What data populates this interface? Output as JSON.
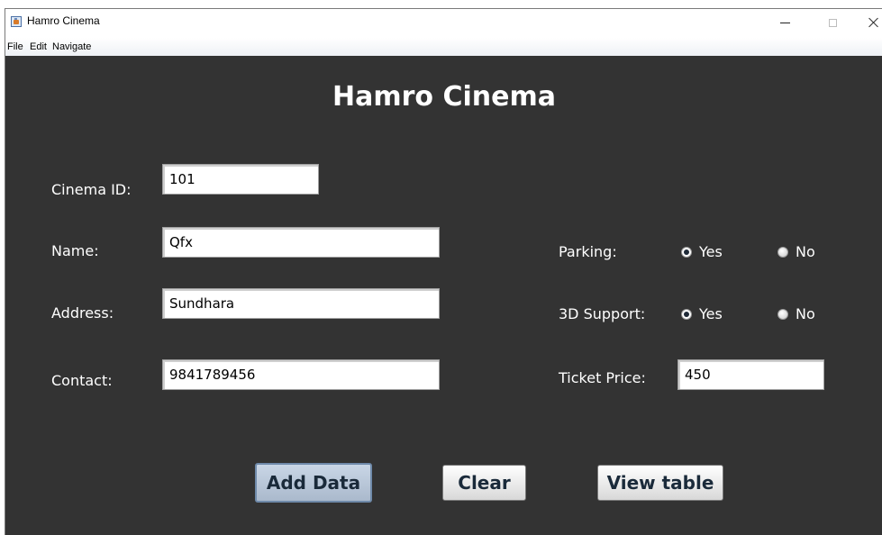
{
  "window": {
    "title": "Hamro Cinema",
    "menu": [
      "File",
      "Edit",
      "Navigate"
    ]
  },
  "form": {
    "heading": "Hamro Cinema",
    "cinema_id": {
      "label": "Cinema ID:",
      "value": "101"
    },
    "name": {
      "label": "Name:",
      "value": "Qfx"
    },
    "address": {
      "label": "Address:",
      "value": "Sundhara"
    },
    "contact": {
      "label": "Contact:",
      "value": "9841789456"
    },
    "parking": {
      "label": "Parking:",
      "options": [
        "Yes",
        "No"
      ],
      "selected": "Yes"
    },
    "support_3d": {
      "label": "3D Support:",
      "options": [
        "Yes",
        "No"
      ],
      "selected": "Yes"
    },
    "ticket_price": {
      "label": "Ticket Price:",
      "value": "450"
    }
  },
  "buttons": {
    "add": "Add Data",
    "clear": "Clear",
    "view": "View table"
  },
  "colors": {
    "panel_background": "#333333",
    "text": "#ffffff",
    "focused_button": "#c9d6e6"
  }
}
